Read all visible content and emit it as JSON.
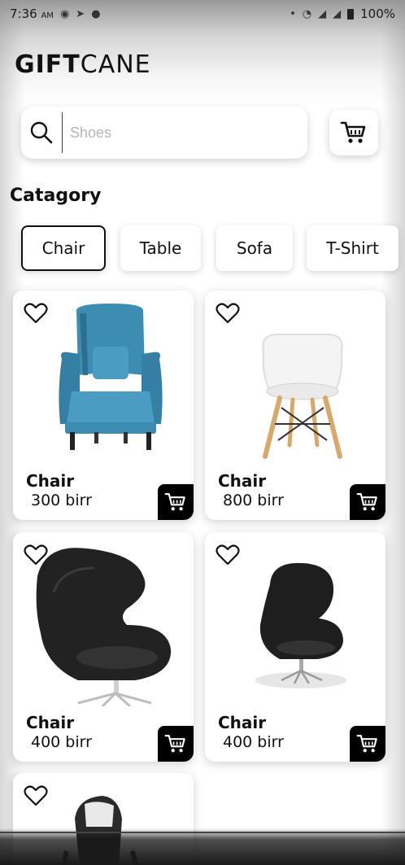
{
  "status_bar": {
    "time": "7:36",
    "ampm": "AM",
    "battery": "100%"
  },
  "logo": {
    "bold": "GIFT",
    "light": "CANE"
  },
  "search": {
    "placeholder": "Shoes",
    "value": ""
  },
  "section_title": "Catagory",
  "categories": [
    {
      "label": "Chair",
      "active": true
    },
    {
      "label": "Table",
      "active": false
    },
    {
      "label": "Sofa",
      "active": false
    },
    {
      "label": "T-Shirt",
      "active": false
    }
  ],
  "products": [
    {
      "name": "Chair",
      "price": "300 birr",
      "image": "blue-armchair"
    },
    {
      "name": "Chair",
      "price": "800 birr",
      "image": "white-eames-chair"
    },
    {
      "name": "Chair",
      "price": "400 birr",
      "image": "black-egg-chair"
    },
    {
      "name": "Chair",
      "price": "400 birr",
      "image": "black-egg-chair-small"
    }
  ],
  "colors": {
    "accent": "#000000",
    "chair_blue": "#3d8db3"
  }
}
